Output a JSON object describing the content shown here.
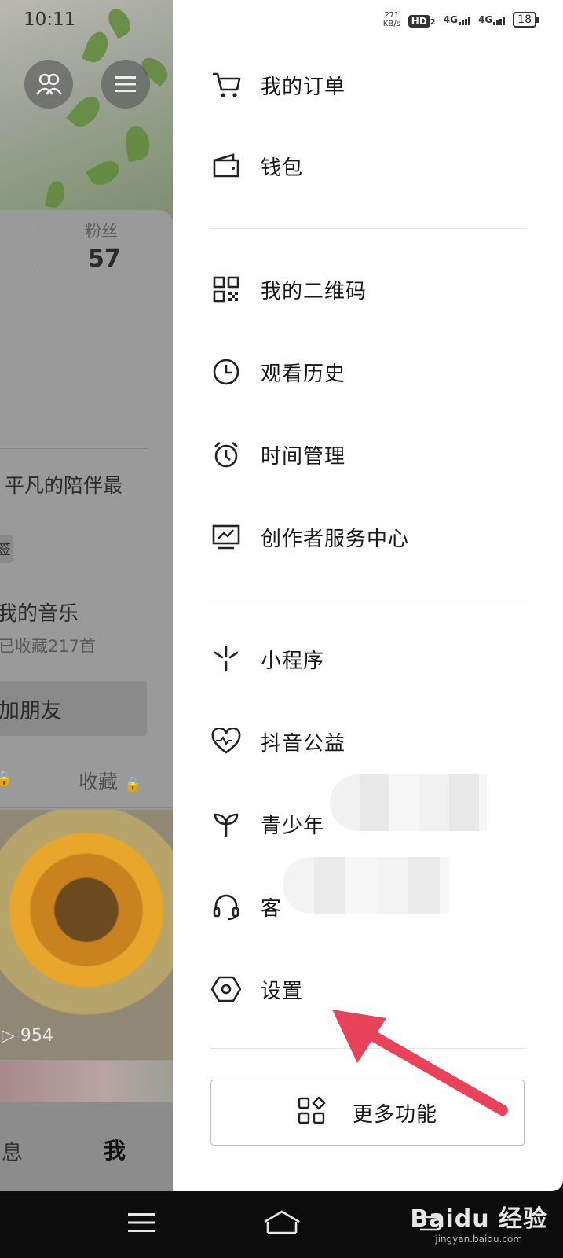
{
  "status_bar": {
    "time": "10:11",
    "net_speed_value": "271",
    "net_speed_unit": "KB/s",
    "hd": "HD",
    "hd_sub": "2",
    "net1": "4G",
    "net2": "4G",
    "battery": "18"
  },
  "profile_bg": {
    "fans_label": "粉丝",
    "fans_count": "57",
    "bio": "平凡的陪伴最",
    "tag_text": "签",
    "music_title": "我的音乐",
    "music_sub": "已收藏217首",
    "add_friend": "加朋友",
    "tab_favorites": "收藏",
    "play_count": "954",
    "bottom_messages": "息",
    "bottom_me": "我"
  },
  "drawer": {
    "items": [
      {
        "label": "我的订单",
        "icon": "cart-icon"
      },
      {
        "label": "钱包",
        "icon": "wallet-icon"
      },
      {
        "label": "我的二维码",
        "icon": "qrcode-icon"
      },
      {
        "label": "观看历史",
        "icon": "clock-icon"
      },
      {
        "label": "时间管理",
        "icon": "alarm-clock-icon"
      },
      {
        "label": "创作者服务中心",
        "icon": "monitor-chart-icon"
      },
      {
        "label": "小程序",
        "icon": "mini-program-icon"
      },
      {
        "label": "抖音公益",
        "icon": "heart-icon"
      },
      {
        "label": "青少年",
        "icon": "sprout-icon"
      },
      {
        "label": "客",
        "icon": "headset-icon"
      },
      {
        "label": "设置",
        "icon": "settings-hexagon-icon"
      }
    ],
    "more_button": "更多功能"
  },
  "watermark": {
    "main": "Baidu 经验",
    "sub": "jingyan.baidu.com"
  },
  "colors": {
    "arrow": "#e8435a",
    "drawer_bg": "#ffffff",
    "overlay": "#8f8f8f"
  }
}
